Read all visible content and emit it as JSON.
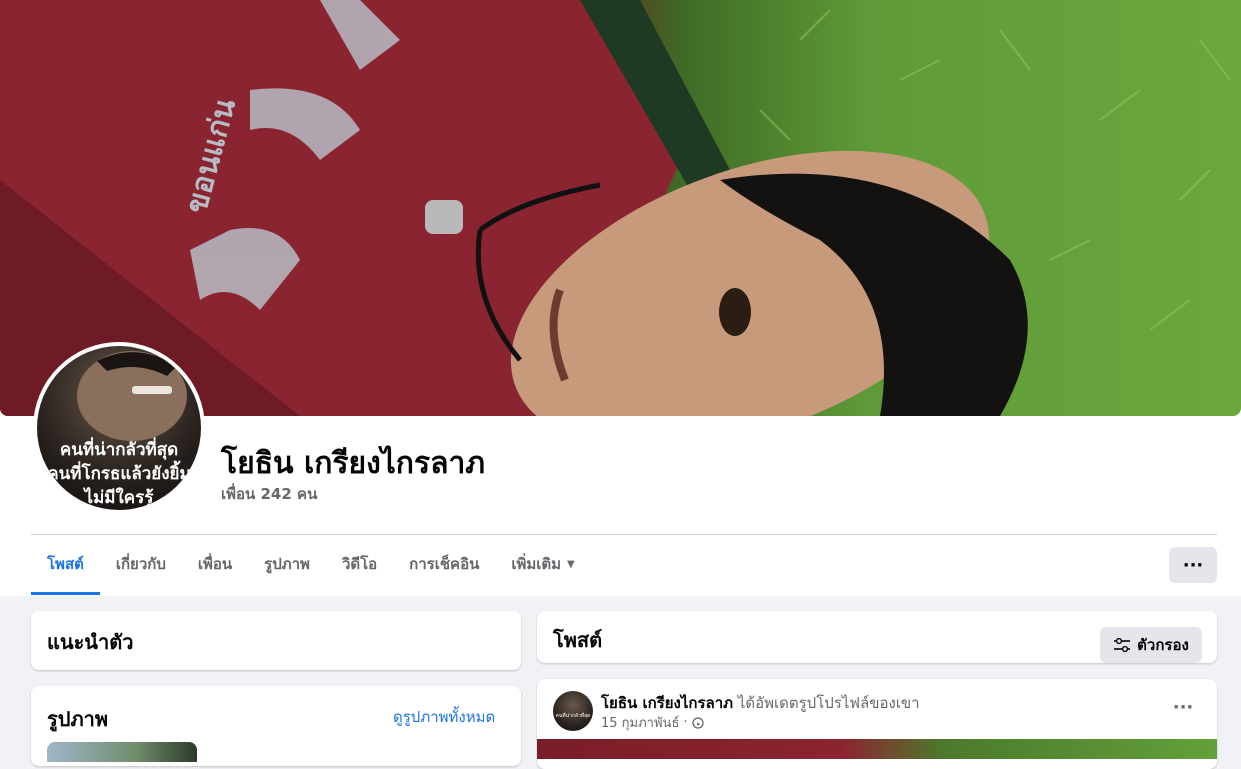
{
  "profile": {
    "name": "โยธิน เกรียงไกรลาภ",
    "friends": "เพื่อน 242 คน",
    "avatar_caption_lines": [
      "คนที่น่ากลัวที่สุด",
      "คนที่โกรธแล้วยังยิ้ม",
      "ไม่มีใครรู้"
    ]
  },
  "cover": {
    "shirt_text": "ขอนแก่น",
    "description": "cover-photo"
  },
  "tabs": [
    {
      "label": "โพสต์",
      "active": true
    },
    {
      "label": "เกี่ยวกับ",
      "active": false
    },
    {
      "label": "เพื่อน",
      "active": false
    },
    {
      "label": "รูปภาพ",
      "active": false
    },
    {
      "label": "วิดีโอ",
      "active": false
    },
    {
      "label": "การเช็คอิน",
      "active": false
    },
    {
      "label": "เพิ่มเติม",
      "active": false
    }
  ],
  "more_button": "···",
  "intro": {
    "title": "แนะนำตัว"
  },
  "photos": {
    "title": "รูปภาพ",
    "see_all": "ดูรูปภาพทั้งหมด"
  },
  "posts_header": {
    "title": "โพสต์",
    "filter_label": "ตัวกรอง"
  },
  "post": {
    "author": "โยธิน เกรียงไกรลาภ",
    "action": "ได้อัพเดตรูปโปรไฟล์ของเขา",
    "date": "15 กุมภาพันธ์",
    "separator": "·",
    "menu": "···"
  },
  "colors": {
    "accent": "#1b74e4",
    "secondary_text": "#65676b",
    "page_bg": "#f0f2f5",
    "button_bg": "#e4e6eb"
  }
}
